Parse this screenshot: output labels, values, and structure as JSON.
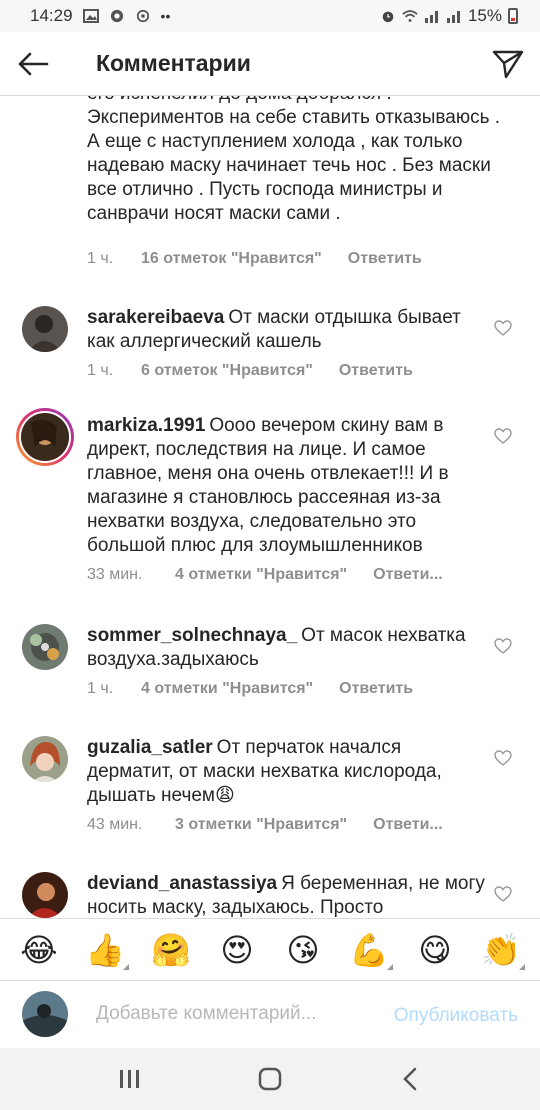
{
  "status_bar": {
    "time": "14:29",
    "battery": "15%"
  },
  "header": {
    "title": "Комментарии"
  },
  "previous_comment": {
    "text": "его испепелил до дома добрался . Экспериментов на себе ставить отказываюсь . А еще с наступлением холода , как только надеваю маску начинает течь нос . Без маски все отлично . Пусть господа министры и санврачи носят маски сами .",
    "time": "1 ч.",
    "likes": "16 отметок \"Нравится\"",
    "reply": "Ответить"
  },
  "comments": [
    {
      "username": "sarakereibaeva",
      "text": "От маски отдышка бывает как аллергический кашель",
      "time": "1 ч.",
      "likes": "6 отметок \"Нравится\"",
      "reply": "Ответить"
    },
    {
      "username": "markiza.1991",
      "text": "Оооо вечером скину вам в директ,  последствия на лице.  И самое главное,  меня она очень отвлекает!!! И в магазине я становлюсь рассеяная из-за нехватки воздуха,  следовательно это большой плюс для злоумышленников",
      "time": "33 мин.",
      "likes": "4 отметки \"Нравится\"",
      "reply": "Ответи..."
    },
    {
      "username": "sommer_solnechnaya_",
      "text": "От масок нехватка воздуха.задыхаюсь",
      "time": "1 ч.",
      "likes": "4 отметки \"Нравится\"",
      "reply": "Ответить"
    },
    {
      "username": "guzalia_satler",
      "text": "От перчаток начался дерматит, от маски нехватка кислорода, дышать нечем😩",
      "time": "43 мин.",
      "likes": "3 отметки \"Нравится\"",
      "reply": "Ответи..."
    },
    {
      "username": "deviand_anastassiya",
      "text": "Я беременная, не могу носить маску, задыхаюсь. Просто",
      "time": "",
      "likes": "",
      "reply": ""
    }
  ],
  "emoji_bar": [
    "😂",
    "👍",
    "🤗",
    "😍",
    "😘",
    "💪",
    "😋",
    "👏"
  ],
  "input": {
    "placeholder": "Добавьте комментарий...",
    "publish_label": "Опубликовать"
  }
}
